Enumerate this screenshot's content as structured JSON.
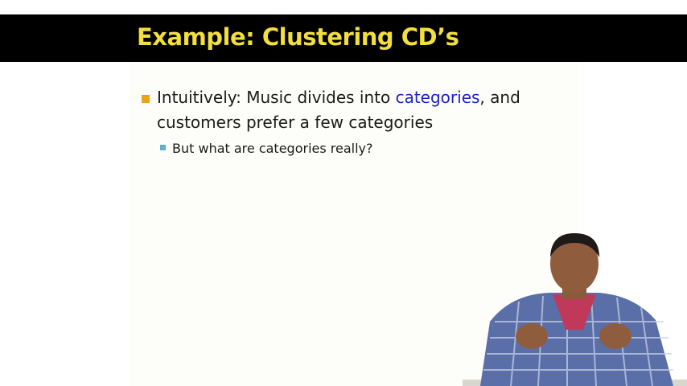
{
  "slide": {
    "title": "Example: Clustering CD’s",
    "bullet1": {
      "before": "Intuitively: Music divides into ",
      "highlight": "categories",
      "after": ", and customers prefer a few categories"
    },
    "bullet2": "But what are categories really?"
  },
  "colors": {
    "title_bar": "#000000",
    "title_text": "#f2de3c",
    "highlight": "#1f22c4",
    "bullet_primary": "#e8a51a",
    "bullet_secondary": "#5fb0c8"
  }
}
